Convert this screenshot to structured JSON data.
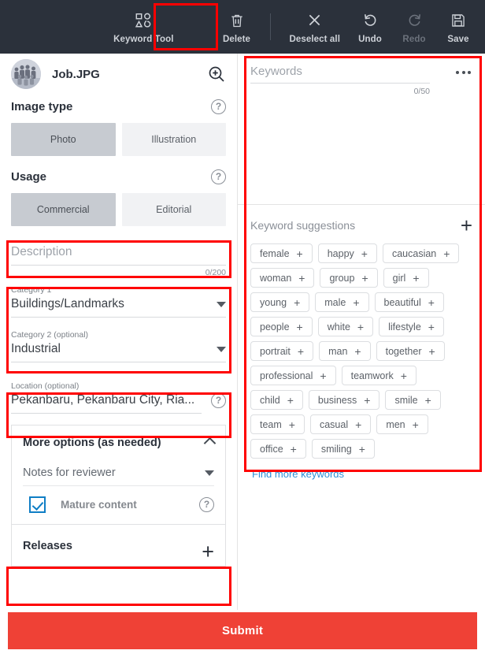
{
  "toolbar": {
    "keyword_tool": {
      "label": "Keyword Tool",
      "icon": "shapes-icon",
      "highlighted": true
    },
    "delete": {
      "label": "Delete",
      "icon": "trash-icon"
    },
    "deselect_all": {
      "label": "Deselect all",
      "icon": "close-x-icon"
    },
    "undo": {
      "label": "Undo",
      "icon": "undo-arrow-icon"
    },
    "redo": {
      "label": "Redo",
      "icon": "redo-arrow-icon",
      "disabled": true
    },
    "save": {
      "label": "Save",
      "icon": "floppy-disk-icon"
    }
  },
  "file": {
    "name": "Job.JPG",
    "zoom_icon": "magnifier-plus-icon"
  },
  "image_type": {
    "heading": "Image type",
    "help_icon": "question-mark-icon",
    "options": [
      {
        "label": "Photo",
        "selected": true
      },
      {
        "label": "Illustration",
        "selected": false
      }
    ]
  },
  "usage": {
    "heading": "Usage",
    "help_icon": "question-mark-icon",
    "options": [
      {
        "label": "Commercial",
        "selected": true
      },
      {
        "label": "Editorial",
        "selected": false
      }
    ]
  },
  "description": {
    "placeholder": "Description",
    "value": "",
    "counter": "0/200"
  },
  "category1": {
    "label": "Category 1",
    "value": "Buildings/Landmarks"
  },
  "category2": {
    "label": "Category 2 (optional)",
    "value": "Industrial"
  },
  "location": {
    "label": "Location (optional)",
    "value": "Pekanbaru, Pekanbaru City, Ria...",
    "help_icon": "question-mark-icon"
  },
  "more_options": {
    "title": "More options (as needed)",
    "expanded": true,
    "notes_label": "Notes for reviewer",
    "mature_label": "Mature content",
    "mature_checked": true,
    "mature_help_icon": "question-mark-icon"
  },
  "releases": {
    "title": "Releases",
    "add_icon": "plus-icon"
  },
  "keywords": {
    "placeholder": "Keywords",
    "counter": "0/50",
    "menu_icon": "more-horizontal-icon"
  },
  "suggestions": {
    "title": "Keyword suggestions",
    "add_icon": "plus-icon",
    "items": [
      "female",
      "happy",
      "caucasian",
      "woman",
      "group",
      "girl",
      "young",
      "male",
      "beautiful",
      "people",
      "white",
      "lifestyle",
      "portrait",
      "man",
      "together",
      "professional",
      "teamwork",
      "child",
      "business",
      "smile",
      "team",
      "casual",
      "men",
      "office",
      "smiling"
    ],
    "add_chip_icon": "plus-icon",
    "find_more_label": "Find more keywords"
  },
  "submit": {
    "label": "Submit"
  },
  "colors": {
    "toolbar_bg": "#2b313b",
    "accent_red": "#ef4136",
    "annotation_red": "#ff0000",
    "link_blue": "#2f8fd6",
    "checkbox_blue": "#0f7ec5"
  }
}
